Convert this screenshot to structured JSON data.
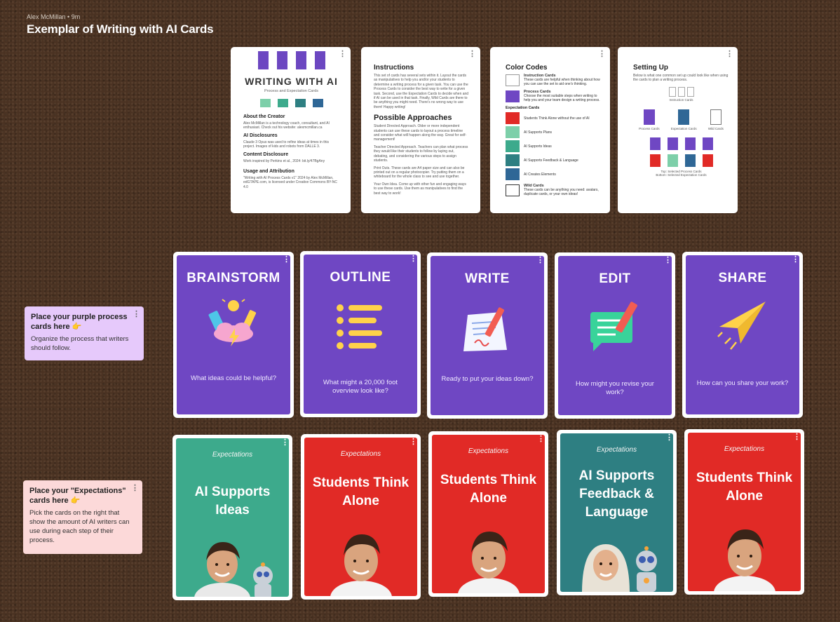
{
  "board": {
    "author": "Alex McMillan",
    "age": "9m",
    "title": "Exemplar of Writing with AI Cards"
  },
  "doc_cards": {
    "cover": {
      "title": "WRITING WITH AI",
      "subtitle": "Process and Expectation Cards",
      "about_heading": "About the Creator",
      "about_text": "Alex McMillan is a technology coach, consultant, and AI enthusiast. Check out his website: alexmcmillan.ca",
      "disclosure_heading": "AI Disclosures",
      "disclosure_text": "Claude 3 Opus was used to refine ideas at times in this project. Images of kids and robots from DALLE 3.",
      "content_heading": "Content Disclosure",
      "content_text": "Work inspired by Perkins et al., 2024: bit.ly/47BgAny",
      "usage_heading": "Usage and Attribution",
      "usage_text": "\"Writing with AI Process Cards v1\" 2024 by Alex McMillan, edGTAPE.com, is licensed under Creative Commons BY-NC 4.0"
    },
    "instructions": {
      "heading": "Instructions",
      "text": "This set of cards has several sets within it. Layout the cards as manipulatives to help you and/or your students to determine a writing process for a given task. You can use the Process Cards to consider the best way to write for a given task. Second, use the Expectation Cards to decide when and if AI can be used in that task. Finally, Wild Cards are there to be anything you might need. There's no wrong way to use them! Happy writing!",
      "approaches_heading": "Possible Approaches",
      "approach_1": "Student Directed Approach. Older or more independent students can use these cards to layout a process timeline and consider what will happen along the way. Great for self-management!",
      "approach_2": "Teacher Directed Approach. Teachers can plan what process they would like their students to follow by laying out, debating, and considering the various steps to assign students.",
      "approach_3": "Print Outs. These cards are A4 paper size and can also be printed out on a regular photocopier. Try putting them on a whiteboard for the whole class to see and use together.",
      "approach_4": "Your Own Idea. Come up with other fun and engaging ways to use these cards. Use them as manipulatives to find the best way to work!"
    },
    "color_codes": {
      "heading": "Color Codes",
      "instruction_label": "Instruction Cards",
      "instruction_desc": "These cards are helpful when thinking about how you can use the set to aid one's thinking.",
      "process_label": "Process Cards",
      "process_desc": "Choose the most suitable steps when writing to help you and your team design a writing process.",
      "expectation_label": "Expectation Cards",
      "exp_items": [
        "Students Think Alone without the use of AI",
        "AI Supports Plans",
        "AI Supports Ideas",
        "AI Supports Feedback & Language",
        "AI Creates Elements"
      ],
      "wild_label": "Wild Cards",
      "wild_desc": "These cards can be anything you need: avatars, duplicate cards, or your own ideas!"
    },
    "setting_up": {
      "heading": "Setting Up",
      "text": "Below is what one common set up could look like when using the cards to plan a writing process.",
      "instruction_cards": "Instruction Cards",
      "process_cards": "Process Cards",
      "expectation_cards": "Expectation Cards",
      "wild_cards": "Wild Cards",
      "caption_top": "Top: Selected Process Cards",
      "caption_bottom": "Bottom: Selected Expectation Cards"
    }
  },
  "process_cards": [
    {
      "title": "BRAINSTORM",
      "question": "What ideas could be helpful?",
      "icon": "brainstorm-icon"
    },
    {
      "title": "OUTLINE",
      "question": "What might a 20,000 foot overview look like?",
      "icon": "list-icon"
    },
    {
      "title": "WRITE",
      "question": "Ready to put your ideas down?",
      "icon": "pencil-paper-icon"
    },
    {
      "title": "EDIT",
      "question": "How might you revise your work?",
      "icon": "edit-message-icon"
    },
    {
      "title": "SHARE",
      "question": "How can you share your work?",
      "icon": "paper-plane-icon"
    }
  ],
  "expectation_cards": [
    {
      "tag": "Expectations",
      "title": "AI Supports Ideas",
      "color": "#3daa8c"
    },
    {
      "tag": "Expectations",
      "title": "Students Think Alone",
      "color": "#e12a26"
    },
    {
      "tag": "Expectations",
      "title": "Students Think Alone",
      "color": "#e12a26"
    },
    {
      "tag": "Expectations",
      "title": "AI Supports Feedback & Language",
      "color": "#2e7f82"
    },
    {
      "tag": "Expectations",
      "title": "Students Think Alone",
      "color": "#e12a26"
    }
  ],
  "stickies": {
    "process": {
      "title": "Place your purple process cards here 👉",
      "body": "Organize the process that writers should follow.",
      "color": "#e6c9fb"
    },
    "expectations": {
      "title": "Place your \"Expectations\" cards here 👉",
      "body": "Pick the cards on the right that show the amount of AI writers can use during each step of their process.",
      "color": "#fcd9d9"
    }
  },
  "colors": {
    "purple": "#6f47c3",
    "red": "#e12a26",
    "green": "#3daa8c",
    "teal": "#2e7f82",
    "light_green": "#7dcfa9",
    "blue": "#2f6796"
  }
}
